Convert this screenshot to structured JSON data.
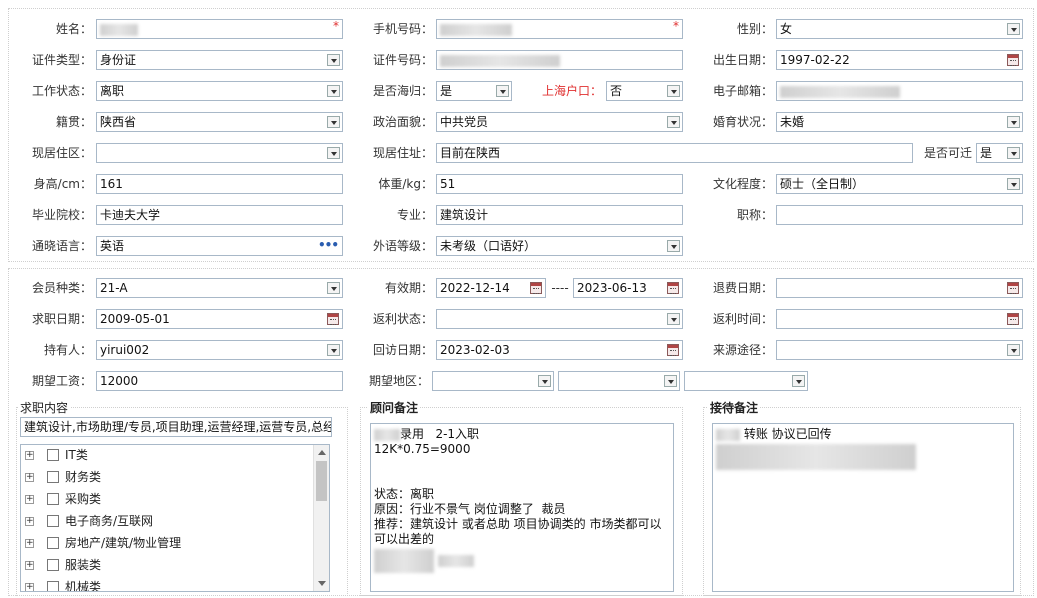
{
  "labels": {
    "name": "姓名：",
    "phone": "手机号码：",
    "gender": "性别：",
    "id_type": "证件类型：",
    "id_number": "证件号码：",
    "birth_date": "出生日期：",
    "work_status": "工作状态：",
    "returnee": "是否海归：",
    "shanghai_hukou": "上海户口：",
    "email": "电子邮箱：",
    "native_place": "籍贯：",
    "political_status": "政治面貌：",
    "marital_status": "婚育状况：",
    "residence_area": "现居住区：",
    "residence_address": "现居住址：",
    "relocatable": "是否可迁",
    "height": "身高/cm：",
    "weight": "体重/kg：",
    "education": "文化程度：",
    "school": "毕业院校：",
    "major": "专业：",
    "title": "职称：",
    "languages": "通晓语言：",
    "language_level": "外语等级：",
    "member_type": "会员种类：",
    "validity": "有效期：",
    "refund_date": "退费日期：",
    "job_date": "求职日期：",
    "rebate_status": "返利状态：",
    "rebate_time": "返利时间：",
    "holder": "持有人：",
    "followup_date": "回访日期：",
    "source": "来源途径：",
    "expected_salary": "期望工资：",
    "expected_region": "期望地区：",
    "date_separator": "----"
  },
  "values": {
    "name": "",
    "phone": "",
    "required_mark": "*",
    "gender": "女",
    "id_type": "身份证",
    "id_number": "",
    "birth_date": "1997-02-22",
    "work_status": "离职",
    "returnee": "是",
    "shanghai_hukou": "否",
    "email": "",
    "native_place": "陕西省",
    "political_status": "中共党员",
    "marital_status": "未婚",
    "residence_area": "",
    "residence_address": "目前在陕西",
    "relocatable": "是",
    "height": "161",
    "weight": "51",
    "education": "硕士（全日制）",
    "school": "卡迪夫大学",
    "major": "建筑设计",
    "title": "",
    "languages": "英语",
    "language_level": "未考级（口语好）",
    "member_type": "21-A",
    "validity_start": "2022-12-14",
    "validity_end": "2023-06-13",
    "refund_date": "",
    "job_date": "2009-05-01",
    "rebate_status": "",
    "rebate_time": "",
    "holder": "yirui002",
    "followup_date": "2023-02-03",
    "source": "",
    "expected_salary": "12000",
    "expected_region_1": "",
    "expected_region_2": "",
    "expected_region_3": ""
  },
  "job_content": {
    "title": "求职内容",
    "summary": "建筑设计,市场助理/专员,项目助理,运营经理,运营专员,总经",
    "categories": [
      "IT类",
      "财务类",
      "采购类",
      "电子商务/互联网",
      "房地产/建筑/物业管理",
      "服装类",
      "机械类"
    ]
  },
  "advisor_notes": {
    "title": "顾问备注",
    "line1": "录用   2-1入职",
    "line2": "12K*0.75=9000",
    "line3": "状态：离职",
    "line4": "原因：行业不景气 岗位调整了  裁员",
    "line5": "推荐：建筑设计 或者总助 项目协调类的 市场类都可以",
    "line6": "可以出差的"
  },
  "reception_notes": {
    "title": "接待备注",
    "line1": "转账 协议已回传"
  },
  "icons": {
    "dropdown": "chevron-down-icon",
    "calendar": "calendar-icon",
    "more": "ellipsis-icon",
    "expand": "plus-box-icon"
  }
}
